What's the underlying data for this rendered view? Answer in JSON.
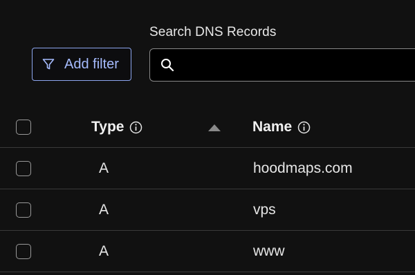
{
  "toolbar": {
    "filter_label": "Add filter",
    "filter_icon": "filter-icon",
    "search_label": "Search DNS Records",
    "search_value": "",
    "search_icon": "search-icon"
  },
  "table": {
    "columns": [
      {
        "label": "Type",
        "icon": "info-icon",
        "sort": "ascending"
      },
      {
        "label": "Name",
        "icon": "info-icon"
      }
    ],
    "rows": [
      {
        "type": "A",
        "name": "hoodmaps.com",
        "checked": false
      },
      {
        "type": "A",
        "name": "vps",
        "checked": false
      },
      {
        "type": "A",
        "name": "www",
        "checked": false
      }
    ]
  },
  "colors": {
    "background": "#111111",
    "accent": "#a6bcff",
    "border": "#3a3a3a"
  }
}
